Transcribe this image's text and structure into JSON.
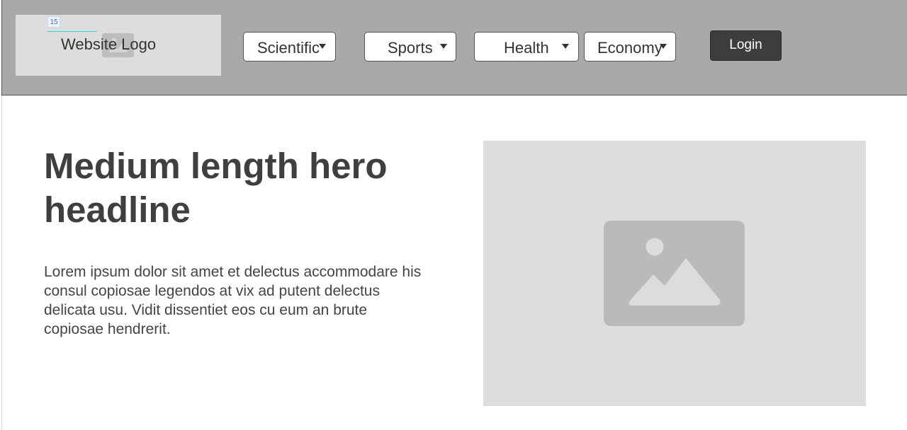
{
  "header": {
    "logo": {
      "badge": "15",
      "text": "Website Logo",
      "icon": "image-placeholder-icon"
    },
    "nav": [
      {
        "label": "Scientific",
        "icon": "caret-down-icon"
      },
      {
        "label": "Sports",
        "icon": "caret-down-icon"
      },
      {
        "label": "Health",
        "icon": "caret-down-icon"
      },
      {
        "label": "Economy",
        "icon": "caret-down-icon"
      }
    ],
    "login_label": "Login"
  },
  "hero": {
    "headline": "Medium length hero headline",
    "body": "Lorem ipsum dolor sit amet et delectus accommodare his consul copiosae legendos at vix ad putent delectus delicata usu. Vidit dissentiet eos cu eum an brute copiosae hendrerit.",
    "image_icon": "image-placeholder-icon"
  },
  "colors": {
    "header_bg": "#a9a9a9",
    "placeholder_bg": "#dddddd",
    "placeholder_icon": "#bababa",
    "login_bg": "#3d3d3d",
    "text": "#3f3f3f"
  }
}
